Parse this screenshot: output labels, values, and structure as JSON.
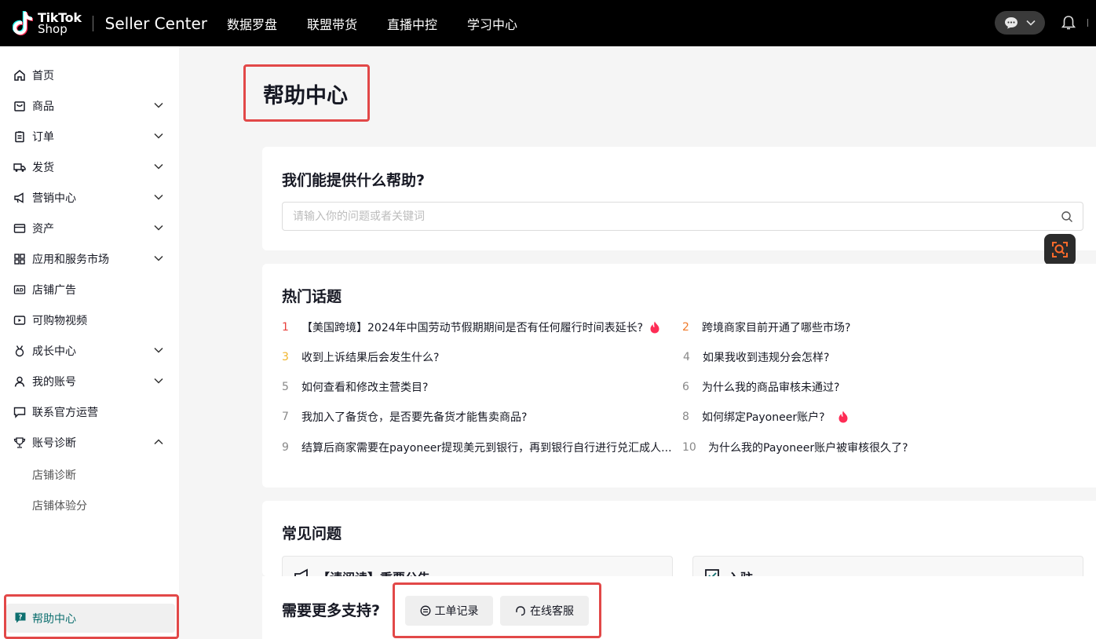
{
  "topbar": {
    "logo_line1": "TikTok",
    "logo_line2": "Shop",
    "product_name": "Seller Center",
    "nav": [
      "数据罗盘",
      "联盟带货",
      "直播中控",
      "学习中心"
    ]
  },
  "sidebar": {
    "items": [
      {
        "label": "首页",
        "icon": "home-icon",
        "expandable": false
      },
      {
        "label": "商品",
        "icon": "bag-icon",
        "expandable": true
      },
      {
        "label": "订单",
        "icon": "clipboard-icon",
        "expandable": true
      },
      {
        "label": "发货",
        "icon": "truck-icon",
        "expandable": true
      },
      {
        "label": "营销中心",
        "icon": "megaphone-icon",
        "expandable": true
      },
      {
        "label": "资产",
        "icon": "wallet-icon",
        "expandable": true
      },
      {
        "label": "应用和服务市场",
        "icon": "apps-icon",
        "expandable": true
      },
      {
        "label": "店铺广告",
        "icon": "ad-icon",
        "expandable": false
      },
      {
        "label": "可购物视频",
        "icon": "video-icon",
        "expandable": false
      },
      {
        "label": "成长中心",
        "icon": "medal-icon",
        "expandable": true
      },
      {
        "label": "我的账号",
        "icon": "user-icon",
        "expandable": true
      },
      {
        "label": "联系官方运营",
        "icon": "chat-icon",
        "expandable": false
      },
      {
        "label": "账号诊断",
        "icon": "trophy-icon",
        "expandable": true,
        "expanded": true
      }
    ],
    "sub_items": [
      "店铺诊断",
      "店铺体验分"
    ],
    "help": {
      "label": "帮助中心",
      "icon": "help-icon"
    }
  },
  "main": {
    "page_title": "帮助中心",
    "search_card": {
      "title": "我们能提供什么帮助?",
      "placeholder": "请输入你的问题或者关键词"
    },
    "hot_topics": {
      "title": "热门话题",
      "items": [
        {
          "rank": "1",
          "text": "【美国跨境】2024年中国劳动节假期期间是否有任何履行时间表延长?",
          "hot": true
        },
        {
          "rank": "2",
          "text": "跨境商家目前开通了哪些市场?",
          "hot": false
        },
        {
          "rank": "3",
          "text": "收到上诉结果后会发生什么?",
          "hot": false
        },
        {
          "rank": "4",
          "text": "如果我收到违规分会怎样?",
          "hot": false
        },
        {
          "rank": "5",
          "text": "如何查看和修改主营类目?",
          "hot": false
        },
        {
          "rank": "6",
          "text": "为什么我的商品审核未通过?",
          "hot": false
        },
        {
          "rank": "7",
          "text": "我加入了备货仓，是否要先备货才能售卖商品?",
          "hot": false
        },
        {
          "rank": "8",
          "text": "如何绑定Payoneer账户?",
          "hot": true
        },
        {
          "rank": "9",
          "text": "结算后商家需要在payoneer提现美元到银行，再到银行自行进行兑汇成人...",
          "hot": false
        },
        {
          "rank": "10",
          "text": "为什么我的Payoneer账户被审核很久了?",
          "hot": false
        }
      ]
    },
    "faq": {
      "title": "常见问题",
      "boxes": [
        {
          "label": "【请阅读】重要公告",
          "icon": "megaphone-icon"
        },
        {
          "label": "入驻",
          "icon": "checklist-icon"
        }
      ]
    },
    "support": {
      "title": "需要更多支持?",
      "ticket_label": "工单记录",
      "service_label": "在线客服"
    }
  },
  "colors": {
    "accent": "#0d6f6f",
    "highlight": "#e24848",
    "rank1": "#e8413c",
    "rank2": "#f07a2a",
    "rank3": "#f0b42a"
  }
}
